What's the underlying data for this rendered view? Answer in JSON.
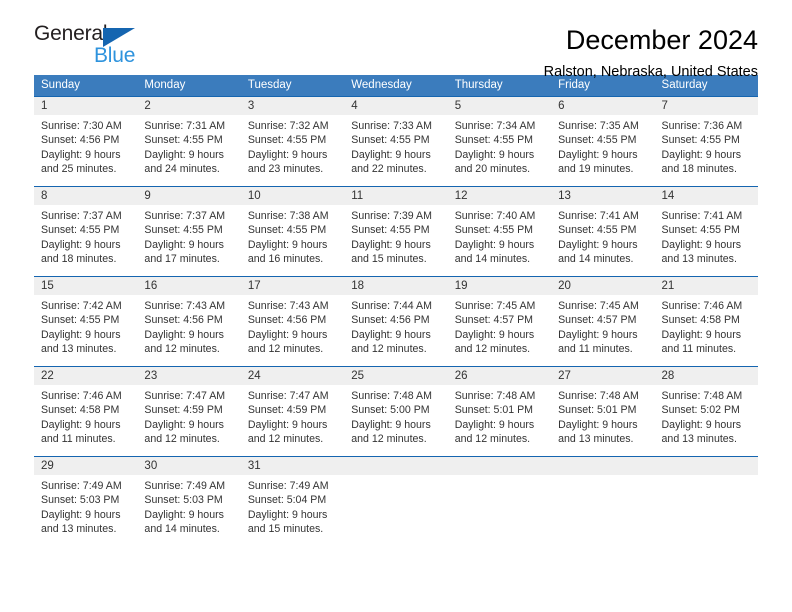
{
  "brand": {
    "name_top": "General",
    "name_bottom": "Blue",
    "triangle_color": "#1565b0",
    "blue_text_color": "#2e93dd",
    "dark_text_color": "#231f20"
  },
  "header": {
    "title": "December 2024",
    "subtitle": "Ralston, Nebraska, United States"
  },
  "colors": {
    "header_row_bg": "#3b7cbd",
    "header_row_text": "#ffffff",
    "row_separator": "#1565b0",
    "daynum_band_bg": "#efefef",
    "body_text": "#333333"
  },
  "labels": {
    "sunrise_prefix": "Sunrise:",
    "sunset_prefix": "Sunset:",
    "daylight_prefix": "Daylight:"
  },
  "weekday_headers": [
    "Sunday",
    "Monday",
    "Tuesday",
    "Wednesday",
    "Thursday",
    "Friday",
    "Saturday"
  ],
  "weeks": [
    [
      {
        "day": "1",
        "sunrise": "Sunrise: 7:30 AM",
        "sunset": "Sunset: 4:56 PM",
        "daylight_line1": "Daylight: 9 hours",
        "daylight_line2": "and 25 minutes."
      },
      {
        "day": "2",
        "sunrise": "Sunrise: 7:31 AM",
        "sunset": "Sunset: 4:55 PM",
        "daylight_line1": "Daylight: 9 hours",
        "daylight_line2": "and 24 minutes."
      },
      {
        "day": "3",
        "sunrise": "Sunrise: 7:32 AM",
        "sunset": "Sunset: 4:55 PM",
        "daylight_line1": "Daylight: 9 hours",
        "daylight_line2": "and 23 minutes."
      },
      {
        "day": "4",
        "sunrise": "Sunrise: 7:33 AM",
        "sunset": "Sunset: 4:55 PM",
        "daylight_line1": "Daylight: 9 hours",
        "daylight_line2": "and 22 minutes."
      },
      {
        "day": "5",
        "sunrise": "Sunrise: 7:34 AM",
        "sunset": "Sunset: 4:55 PM",
        "daylight_line1": "Daylight: 9 hours",
        "daylight_line2": "and 20 minutes."
      },
      {
        "day": "6",
        "sunrise": "Sunrise: 7:35 AM",
        "sunset": "Sunset: 4:55 PM",
        "daylight_line1": "Daylight: 9 hours",
        "daylight_line2": "and 19 minutes."
      },
      {
        "day": "7",
        "sunrise": "Sunrise: 7:36 AM",
        "sunset": "Sunset: 4:55 PM",
        "daylight_line1": "Daylight: 9 hours",
        "daylight_line2": "and 18 minutes."
      }
    ],
    [
      {
        "day": "8",
        "sunrise": "Sunrise: 7:37 AM",
        "sunset": "Sunset: 4:55 PM",
        "daylight_line1": "Daylight: 9 hours",
        "daylight_line2": "and 18 minutes."
      },
      {
        "day": "9",
        "sunrise": "Sunrise: 7:37 AM",
        "sunset": "Sunset: 4:55 PM",
        "daylight_line1": "Daylight: 9 hours",
        "daylight_line2": "and 17 minutes."
      },
      {
        "day": "10",
        "sunrise": "Sunrise: 7:38 AM",
        "sunset": "Sunset: 4:55 PM",
        "daylight_line1": "Daylight: 9 hours",
        "daylight_line2": "and 16 minutes."
      },
      {
        "day": "11",
        "sunrise": "Sunrise: 7:39 AM",
        "sunset": "Sunset: 4:55 PM",
        "daylight_line1": "Daylight: 9 hours",
        "daylight_line2": "and 15 minutes."
      },
      {
        "day": "12",
        "sunrise": "Sunrise: 7:40 AM",
        "sunset": "Sunset: 4:55 PM",
        "daylight_line1": "Daylight: 9 hours",
        "daylight_line2": "and 14 minutes."
      },
      {
        "day": "13",
        "sunrise": "Sunrise: 7:41 AM",
        "sunset": "Sunset: 4:55 PM",
        "daylight_line1": "Daylight: 9 hours",
        "daylight_line2": "and 14 minutes."
      },
      {
        "day": "14",
        "sunrise": "Sunrise: 7:41 AM",
        "sunset": "Sunset: 4:55 PM",
        "daylight_line1": "Daylight: 9 hours",
        "daylight_line2": "and 13 minutes."
      }
    ],
    [
      {
        "day": "15",
        "sunrise": "Sunrise: 7:42 AM",
        "sunset": "Sunset: 4:55 PM",
        "daylight_line1": "Daylight: 9 hours",
        "daylight_line2": "and 13 minutes."
      },
      {
        "day": "16",
        "sunrise": "Sunrise: 7:43 AM",
        "sunset": "Sunset: 4:56 PM",
        "daylight_line1": "Daylight: 9 hours",
        "daylight_line2": "and 12 minutes."
      },
      {
        "day": "17",
        "sunrise": "Sunrise: 7:43 AM",
        "sunset": "Sunset: 4:56 PM",
        "daylight_line1": "Daylight: 9 hours",
        "daylight_line2": "and 12 minutes."
      },
      {
        "day": "18",
        "sunrise": "Sunrise: 7:44 AM",
        "sunset": "Sunset: 4:56 PM",
        "daylight_line1": "Daylight: 9 hours",
        "daylight_line2": "and 12 minutes."
      },
      {
        "day": "19",
        "sunrise": "Sunrise: 7:45 AM",
        "sunset": "Sunset: 4:57 PM",
        "daylight_line1": "Daylight: 9 hours",
        "daylight_line2": "and 12 minutes."
      },
      {
        "day": "20",
        "sunrise": "Sunrise: 7:45 AM",
        "sunset": "Sunset: 4:57 PM",
        "daylight_line1": "Daylight: 9 hours",
        "daylight_line2": "and 11 minutes."
      },
      {
        "day": "21",
        "sunrise": "Sunrise: 7:46 AM",
        "sunset": "Sunset: 4:58 PM",
        "daylight_line1": "Daylight: 9 hours",
        "daylight_line2": "and 11 minutes."
      }
    ],
    [
      {
        "day": "22",
        "sunrise": "Sunrise: 7:46 AM",
        "sunset": "Sunset: 4:58 PM",
        "daylight_line1": "Daylight: 9 hours",
        "daylight_line2": "and 11 minutes."
      },
      {
        "day": "23",
        "sunrise": "Sunrise: 7:47 AM",
        "sunset": "Sunset: 4:59 PM",
        "daylight_line1": "Daylight: 9 hours",
        "daylight_line2": "and 12 minutes."
      },
      {
        "day": "24",
        "sunrise": "Sunrise: 7:47 AM",
        "sunset": "Sunset: 4:59 PM",
        "daylight_line1": "Daylight: 9 hours",
        "daylight_line2": "and 12 minutes."
      },
      {
        "day": "25",
        "sunrise": "Sunrise: 7:48 AM",
        "sunset": "Sunset: 5:00 PM",
        "daylight_line1": "Daylight: 9 hours",
        "daylight_line2": "and 12 minutes."
      },
      {
        "day": "26",
        "sunrise": "Sunrise: 7:48 AM",
        "sunset": "Sunset: 5:01 PM",
        "daylight_line1": "Daylight: 9 hours",
        "daylight_line2": "and 12 minutes."
      },
      {
        "day": "27",
        "sunrise": "Sunrise: 7:48 AM",
        "sunset": "Sunset: 5:01 PM",
        "daylight_line1": "Daylight: 9 hours",
        "daylight_line2": "and 13 minutes."
      },
      {
        "day": "28",
        "sunrise": "Sunrise: 7:48 AM",
        "sunset": "Sunset: 5:02 PM",
        "daylight_line1": "Daylight: 9 hours",
        "daylight_line2": "and 13 minutes."
      }
    ],
    [
      {
        "day": "29",
        "sunrise": "Sunrise: 7:49 AM",
        "sunset": "Sunset: 5:03 PM",
        "daylight_line1": "Daylight: 9 hours",
        "daylight_line2": "and 13 minutes."
      },
      {
        "day": "30",
        "sunrise": "Sunrise: 7:49 AM",
        "sunset": "Sunset: 5:03 PM",
        "daylight_line1": "Daylight: 9 hours",
        "daylight_line2": "and 14 minutes."
      },
      {
        "day": "31",
        "sunrise": "Sunrise: 7:49 AM",
        "sunset": "Sunset: 5:04 PM",
        "daylight_line1": "Daylight: 9 hours",
        "daylight_line2": "and 15 minutes."
      },
      {
        "day": "",
        "sunrise": "",
        "sunset": "",
        "daylight_line1": "",
        "daylight_line2": ""
      },
      {
        "day": "",
        "sunrise": "",
        "sunset": "",
        "daylight_line1": "",
        "daylight_line2": ""
      },
      {
        "day": "",
        "sunrise": "",
        "sunset": "",
        "daylight_line1": "",
        "daylight_line2": ""
      },
      {
        "day": "",
        "sunrise": "",
        "sunset": "",
        "daylight_line1": "",
        "daylight_line2": ""
      }
    ]
  ]
}
